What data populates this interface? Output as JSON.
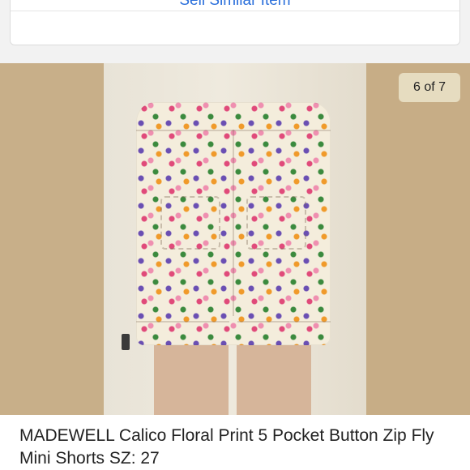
{
  "sell_card": {
    "link_label": "Sell Similar Item"
  },
  "photo": {
    "counter": "6 of 7"
  },
  "listing": {
    "title": "MADEWELL Calico Floral Print 5 Pocket Button Zip Fly Mini Shorts SZ: 27"
  }
}
